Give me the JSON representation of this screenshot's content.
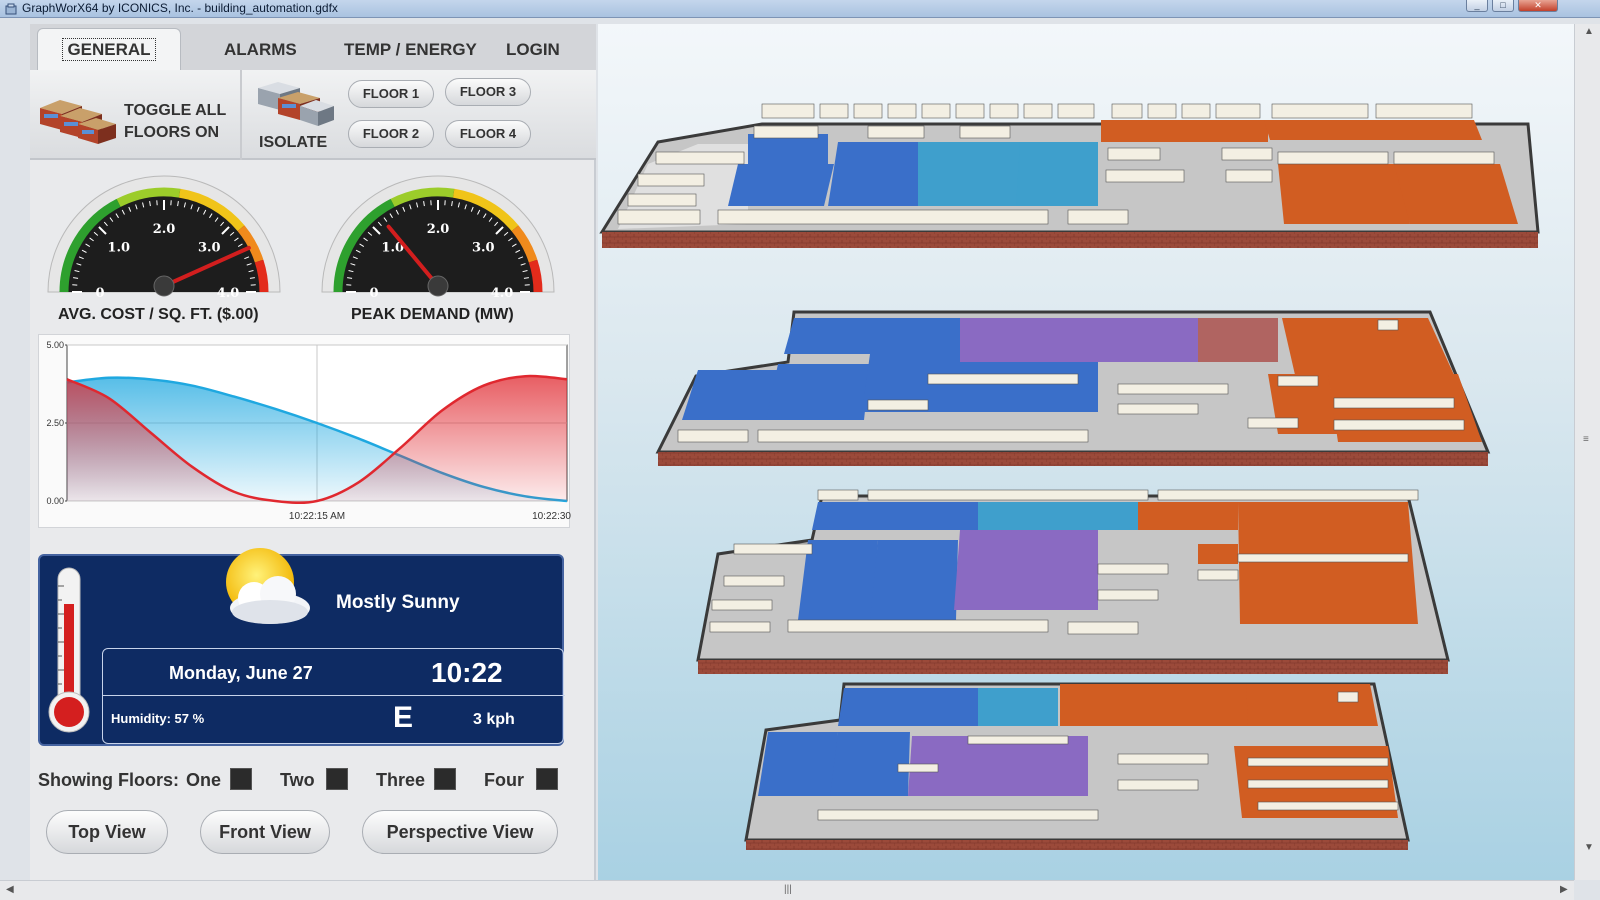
{
  "window": {
    "title": "GraphWorX64 by ICONICS, Inc. - building_automation.gdfx"
  },
  "tabs": [
    {
      "label": "GENERAL",
      "active": true
    },
    {
      "label": "ALARMS",
      "active": false
    },
    {
      "label": "TEMP / ENERGY",
      "active": false
    },
    {
      "label": "LOGIN",
      "active": false
    }
  ],
  "floor_controls": {
    "toggle_all": "TOGGLE ALL",
    "toggle_all_line2": "FLOORS ON",
    "isolate": "ISOLATE",
    "floor_buttons": [
      "FLOOR 1",
      "FLOOR 2",
      "FLOOR 3",
      "FLOOR 4"
    ]
  },
  "gauges": [
    {
      "label": "AVG. COST / SQ. FT. ($.00)",
      "min": 0,
      "max": 4.0,
      "ticks": [
        "0",
        "1.0",
        "2.0",
        "3.0",
        "4.0"
      ],
      "value": 3.4
    },
    {
      "label": "PEAK DEMAND (MW)",
      "min": 0,
      "max": 4.0,
      "ticks": [
        "0",
        "1.0",
        "2.0",
        "3.0",
        "4.0"
      ],
      "value": 1.0
    }
  ],
  "chart_data": {
    "type": "area",
    "y_ticks": [
      "5.00",
      "2.50",
      "0.00"
    ],
    "x_ticks": [
      "10:22:15 AM",
      "10:22:30"
    ],
    "ylim": [
      0,
      5
    ],
    "grid": true,
    "series": [
      {
        "color": "#1fa8e0",
        "x": [
          0,
          2.5,
          5,
          7.5,
          10,
          12.5,
          15,
          17.5,
          20,
          22.5,
          25,
          27.5,
          30
        ],
        "values": [
          3.8,
          3.95,
          3.9,
          3.7,
          3.35,
          2.95,
          2.5,
          2.0,
          1.45,
          0.9,
          0.45,
          0.15,
          0.0
        ]
      },
      {
        "color": "#e0282f",
        "x": [
          0,
          2.5,
          5,
          7.5,
          10,
          12.5,
          15,
          17.5,
          20,
          22.5,
          25,
          27.5,
          30
        ],
        "values": [
          3.9,
          3.3,
          2.2,
          1.1,
          0.3,
          0.0,
          0.0,
          0.6,
          1.7,
          2.9,
          3.7,
          4.0,
          3.9
        ]
      }
    ]
  },
  "weather": {
    "condition": "Mostly Sunny",
    "date": "Monday, June 27",
    "time": "10:22",
    "humidity_label": "Humidity:  57 %",
    "wind_direction": "E",
    "wind_speed": "3  kph"
  },
  "showing_floors": {
    "label": "Showing Floors:",
    "floors": [
      {
        "label": "One",
        "checked": true
      },
      {
        "label": "Two",
        "checked": true
      },
      {
        "label": "Three",
        "checked": true
      },
      {
        "label": "Four",
        "checked": true
      }
    ]
  },
  "views": {
    "top": "Top View",
    "front": "Front View",
    "perspective": "Perspective View"
  },
  "colors": {
    "zone_blue": "#3a6fc9",
    "zone_light_blue": "#3f9fcc",
    "zone_purple": "#8a6ac2",
    "zone_orange": "#d15d22",
    "zone_rose": "#b06461",
    "weather_panel": "#0e2b63"
  }
}
